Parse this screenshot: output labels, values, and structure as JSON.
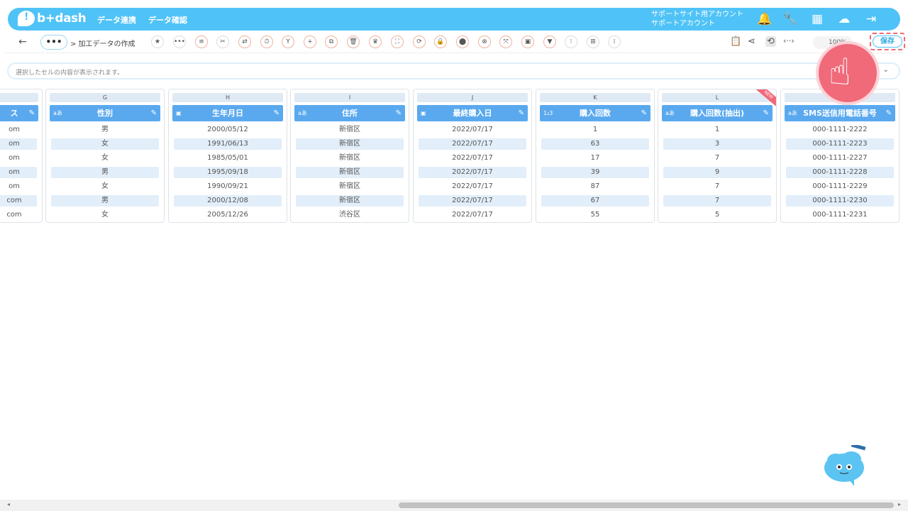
{
  "app": {
    "logo_text": "b+dash"
  },
  "header": {
    "nav": [
      "データ連携",
      "データ確認"
    ],
    "account_line1": "サポートサイト用アカウント",
    "account_line2": "サポートアカウント"
  },
  "toolbar": {
    "back_icon": "arrow-left-icon",
    "more_label": "•••",
    "breadcrumb": "> 加工データの作成",
    "zoom": "100%",
    "save_label": "保存",
    "tools": [
      "★",
      "•••",
      "≡",
      "✂",
      "⇄",
      "⏱",
      "Y",
      "+",
      "⧉",
      "🗑",
      "♛",
      "⛶",
      "⟳",
      "🔒",
      "⬤",
      "⊗",
      "⤧",
      "▣",
      "▼",
      "⁝",
      "⊞",
      "⁞"
    ]
  },
  "formula": {
    "placeholder": "選択したセルの内容が表示されます。"
  },
  "columns": [
    {
      "letter": "",
      "header": "ス",
      "type_icon": "",
      "cells": [
        "om",
        "om",
        "om",
        "om",
        "om",
        "com",
        "com"
      ]
    },
    {
      "letter": "G",
      "header": "性別",
      "type_icon": "aあ",
      "cells": [
        "男",
        "女",
        "女",
        "男",
        "女",
        "男",
        "女"
      ]
    },
    {
      "letter": "H",
      "header": "生年月日",
      "type_icon": "▣",
      "cells": [
        "2000/05/12",
        "1991/06/13",
        "1985/05/01",
        "1995/09/18",
        "1990/09/21",
        "2000/12/08",
        "2005/12/26"
      ]
    },
    {
      "letter": "I",
      "header": "住所",
      "type_icon": "aあ",
      "cells": [
        "新宿区",
        "新宿区",
        "新宿区",
        "新宿区",
        "新宿区",
        "新宿区",
        "渋谷区"
      ]
    },
    {
      "letter": "J",
      "header": "最終購入日",
      "type_icon": "▣",
      "cells": [
        "2022/07/17",
        "2022/07/17",
        "2022/07/17",
        "2022/07/17",
        "2022/07/17",
        "2022/07/17",
        "2022/07/17"
      ]
    },
    {
      "letter": "K",
      "header": "購入回数",
      "type_icon": "1₂3",
      "cells": [
        "1",
        "63",
        "17",
        "39",
        "87",
        "67",
        "55"
      ]
    },
    {
      "letter": "L",
      "header": "購入回数(抽出)",
      "type_icon": "aあ",
      "cells": [
        "1",
        "3",
        "7",
        "9",
        "7",
        "7",
        "5"
      ],
      "badge": "NEW"
    },
    {
      "letter": "",
      "header": "SMS送信用電話番号",
      "type_icon": "aあ",
      "cells": [
        "000-1111-2222",
        "000-1111-2223",
        "000-1111-2227",
        "000-1111-2228",
        "000-1111-2229",
        "000-1111-2230",
        "000-1111-2231"
      ]
    }
  ]
}
